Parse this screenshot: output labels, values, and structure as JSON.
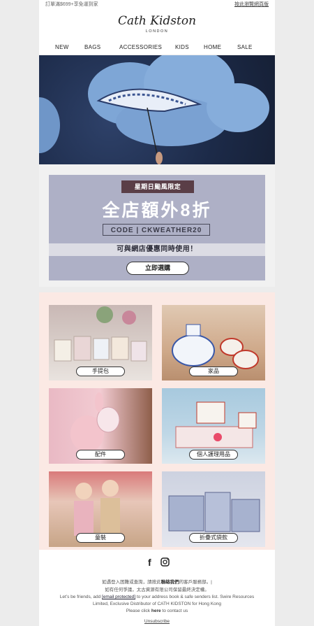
{
  "topbar": {
    "left": "訂單滿$699+享免運到家",
    "right": "按此瀏覽網頁版"
  },
  "header": {
    "brand": "Cath Kidston",
    "brand_sub": "LONDON"
  },
  "nav": [
    {
      "label": "NEW"
    },
    {
      "label": "BAGS"
    },
    {
      "label": "ACCESSORIES"
    },
    {
      "label": "KIDS"
    },
    {
      "label": "HOME"
    },
    {
      "label": "SALE"
    }
  ],
  "promo": {
    "tag": "星期日颱風限定",
    "headline": "全店額外8折",
    "code": "CODE | CKWEATHER20",
    "note": "可與網店優惠同時使用！",
    "button": "立即選購"
  },
  "categories": [
    {
      "label": "手提包"
    },
    {
      "label": "家品"
    },
    {
      "label": "配件"
    },
    {
      "label": "個人護理用品"
    },
    {
      "label": "童裝"
    },
    {
      "label": "折疊式袋款"
    }
  ],
  "footer": {
    "line1a": "如遇登入困難或查詢，請按此",
    "line1b": "聯絡我們",
    "line1c": "的客戶服務部。|",
    "line2": "如有任何爭議，太古資源有限公司保留最終決定權。",
    "line3a": "Let’s be friends, add ",
    "line3b": "[email protected]",
    "line3c": " to your address book & safe senders list. Swire Resources",
    "line4": "Limited, Exclusive Distributor of CATH KIDSTON for Hong Kong",
    "line5a": "Please click ",
    "line5b": "here",
    "line5c": " to contact us",
    "unsubscribe": "Unsubscribe"
  }
}
